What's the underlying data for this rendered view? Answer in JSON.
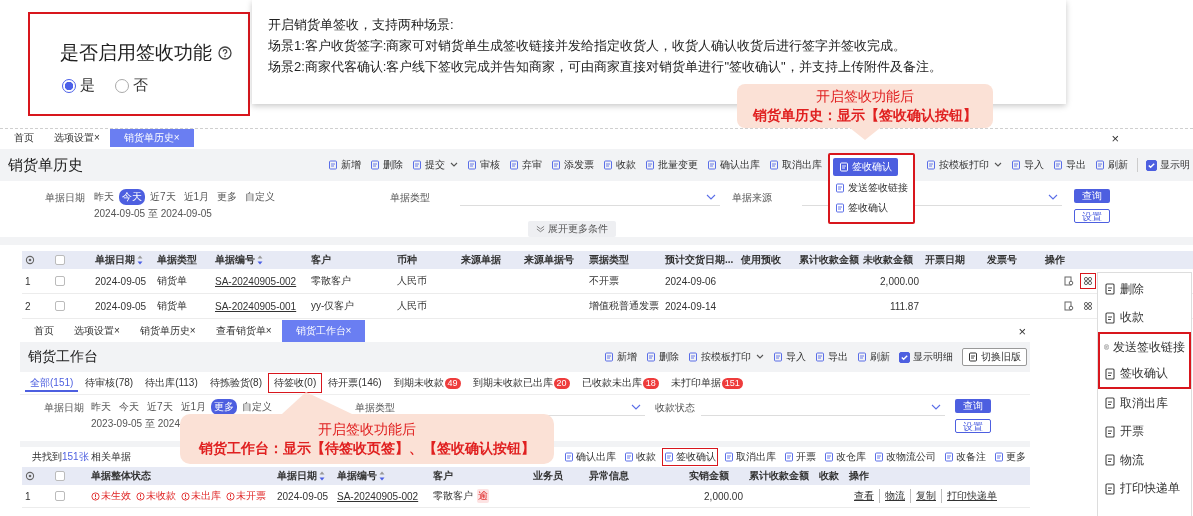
{
  "setting": {
    "title": "是否启用签收功能",
    "options": [
      {
        "label": "是",
        "selected": true
      },
      {
        "label": "否",
        "selected": false
      }
    ]
  },
  "tooltip": {
    "lines": [
      "开启销货单签收，支持两种场景:",
      "场景1:客户收货签字:商家可对销货单生成签收链接并发给指定收货人，收货人确认收货后进行签字并签收完成。",
      "场景2:商家代客确认:客户线下签收完成并告知商家，可由商家直接对销货单进行\"签收确认\"，并支持上传附件及备注。"
    ]
  },
  "callouts": [
    {
      "title": "开启签收功能后",
      "text": "销货单历史：显示【签收确认按钮】"
    },
    {
      "title": "开启签收功能后",
      "text": "销货工作台：显示【待签收页签】、【签收确认按钮】"
    }
  ],
  "history": {
    "tabs": [
      {
        "label": "首页",
        "selected": false
      },
      {
        "label": "选项设置",
        "close": "×",
        "selected": false
      },
      {
        "label": "销货单历史",
        "close": "×",
        "selected": true
      }
    ],
    "close": "×",
    "title": "销货单历史",
    "toolbar": [
      {
        "label": "新增",
        "kind": "button"
      },
      {
        "label": "删除",
        "kind": "button"
      },
      {
        "label": "提交",
        "kind": "dropdown"
      },
      {
        "label": "审核",
        "kind": "button"
      },
      {
        "label": "弃审",
        "kind": "button"
      },
      {
        "label": "添发票",
        "kind": "button"
      },
      {
        "label": "收款",
        "kind": "button"
      },
      {
        "label": "批量变更",
        "kind": "button"
      },
      {
        "label": "确认出库",
        "kind": "button"
      },
      {
        "label": "取消出库",
        "kind": "button"
      },
      {
        "label": "签收确认",
        "kind": "primary",
        "menu": {
          "annotated": true,
          "items": [
            "发送签收链接",
            "签收确认"
          ]
        }
      },
      {
        "label": "按模板打印",
        "kind": "dropdown"
      },
      {
        "label": "导入",
        "kind": "button"
      },
      {
        "label": "导出",
        "kind": "button"
      },
      {
        "label": "刷新",
        "kind": "button"
      },
      {
        "label": "显示明",
        "kind": "checkbox",
        "checked": true
      }
    ],
    "filters": {
      "date_label": "单据日期",
      "chips": [
        {
          "label": "昨天",
          "selected": false
        },
        {
          "label": "今天",
          "selected": true
        },
        {
          "label": "近7天",
          "selected": false
        },
        {
          "label": "近1月",
          "selected": false
        },
        {
          "label": "更多",
          "selected": false
        },
        {
          "label": "自定义",
          "selected": false
        }
      ],
      "date_range": "2024-09-05 至 2024-09-05",
      "selects": [
        "单据类型",
        "单据来源"
      ],
      "buttons": [
        {
          "label": "查询",
          "kind": "primary"
        },
        {
          "label": "设置",
          "kind": "outline"
        }
      ],
      "expand": "展开更多条件"
    },
    "table": {
      "select_all_checked": false,
      "columns": [
        {
          "label": "单据日期",
          "sortable": true
        },
        {
          "label": "单据类型"
        },
        {
          "label": "单据编号",
          "kind": "link",
          "sortable": true
        },
        {
          "label": "客户"
        },
        {
          "label": "币种"
        },
        {
          "label": "来源单据"
        },
        {
          "label": "来源单据号"
        },
        {
          "label": "票据类型"
        },
        {
          "label": "预计交货日期..."
        },
        {
          "label": "使用预收"
        },
        {
          "label": "累计收款金额",
          "kind": "number"
        },
        {
          "label": "未收款金额",
          "kind": "number"
        },
        {
          "label": "开票日期"
        },
        {
          "label": "发票号"
        },
        {
          "label": "操作",
          "kind": "ops"
        }
      ],
      "rows": [
        {
          "no": "1",
          "checked": false,
          "annotated": true,
          "cells": [
            "2024-09-05",
            "销货单",
            "SA-20240905-002",
            "零散客户",
            "人民币",
            null,
            null,
            "不开票",
            "2024-09-06",
            null,
            null,
            "2,000.00",
            null,
            null,
            null
          ]
        },
        {
          "no": "2",
          "checked": false,
          "annotated": false,
          "cells": [
            "2024-09-05",
            "销货单",
            "SA-20240905-001",
            "yy-仅客户",
            "人民币",
            null,
            null,
            "增值税普通发票",
            "2024-09-14",
            null,
            null,
            "111.87",
            null,
            null,
            null
          ]
        }
      ]
    }
  },
  "row_menu": {
    "items": [
      {
        "label": "删除",
        "annotated": false
      },
      {
        "label": "收款",
        "annotated": false
      },
      {
        "label": "发送签收链接",
        "annotated": true
      },
      {
        "label": "签收确认",
        "annotated": true
      },
      {
        "label": "取消出库",
        "annotated": false
      },
      {
        "label": "开票",
        "annotated": false
      },
      {
        "label": "物流",
        "annotated": false
      },
      {
        "label": "打印快递单",
        "annotated": false
      }
    ]
  },
  "workbench": {
    "tabs": [
      {
        "label": "首页",
        "selected": false
      },
      {
        "label": "选项设置",
        "close": "×",
        "selected": false
      },
      {
        "label": "销货单历史",
        "close": "×",
        "selected": false
      },
      {
        "label": "查看销货单",
        "close": "×",
        "selected": false
      },
      {
        "label": "销货工作台",
        "close": "×",
        "selected": true
      }
    ],
    "close": "×",
    "title": "销货工作台",
    "toolbar": [
      {
        "label": "新增",
        "kind": "button"
      },
      {
        "label": "删除",
        "kind": "button"
      },
      {
        "label": "按模板打印",
        "kind": "dropdown"
      },
      {
        "label": "导入",
        "kind": "button"
      },
      {
        "label": "导出",
        "kind": "button"
      },
      {
        "label": "刷新",
        "kind": "button"
      },
      {
        "label": "显示明细",
        "kind": "checkbox",
        "checked": true
      },
      {
        "label": "切换旧版",
        "kind": "outline"
      }
    ],
    "status_tabs": [
      {
        "label": "全部(151)",
        "selected": true,
        "annotated": false
      },
      {
        "label": "待审核(78)",
        "selected": false,
        "annotated": false
      },
      {
        "label": "待出库(113)",
        "selected": false,
        "annotated": false
      },
      {
        "label": "待拣验货(8)",
        "selected": false,
        "annotated": false
      },
      {
        "label": "待签收(0)",
        "selected": false,
        "annotated": true
      },
      {
        "label": "待开票(146)",
        "selected": false,
        "annotated": false
      },
      {
        "label": "到期未收款",
        "badge": "49",
        "selected": false,
        "annotated": false
      },
      {
        "label": "到期未收款已出库",
        "badge": "20",
        "selected": false,
        "annotated": false
      },
      {
        "label": "已收款未出库",
        "badge": "18",
        "selected": false,
        "annotated": false
      },
      {
        "label": "未打印单据",
        "badge": "151",
        "selected": false,
        "annotated": false
      }
    ],
    "filters": {
      "date_label": "单据日期",
      "chips": [
        {
          "label": "昨天",
          "selected": false
        },
        {
          "label": "今天",
          "selected": false
        },
        {
          "label": "近7天",
          "selected": false
        },
        {
          "label": "近1月",
          "selected": false
        },
        {
          "label": "更多",
          "selected": true
        },
        {
          "label": "自定义",
          "selected": false
        }
      ],
      "date_range": "2023-09-05 至 2024",
      "selects": [
        "单据类型",
        "收款状态"
      ],
      "buttons": [
        {
          "label": "查询",
          "kind": "primary"
        },
        {
          "label": "设置",
          "kind": "outline"
        }
      ]
    },
    "result": {
      "prefix": "共找到",
      "count": "151张",
      "suffix": " 相关单据"
    },
    "actions": [
      {
        "label": "确认出库",
        "annotated": false
      },
      {
        "label": "收款",
        "annotated": false
      },
      {
        "label": "签收确认",
        "annotated": true
      },
      {
        "label": "取消出库",
        "annotated": false
      },
      {
        "label": "开票",
        "annotated": false
      },
      {
        "label": "改仓库",
        "annotated": false
      },
      {
        "label": "改物流公司",
        "annotated": false
      },
      {
        "label": "改备注",
        "annotated": false
      },
      {
        "label": "更多",
        "annotated": false
      }
    ],
    "table": {
      "select_all_checked": false,
      "columns": [
        {
          "label": "单据整体状态",
          "kind": "status"
        },
        {
          "label": "单据日期",
          "sortable": true
        },
        {
          "label": "单据编号",
          "kind": "link",
          "sortable": true
        },
        {
          "label": "客户",
          "kind": "customer"
        },
        {
          "label": "业务员"
        },
        {
          "label": "异常信息"
        },
        {
          "label": "实销金额",
          "kind": "number"
        },
        {
          "label": "累计收款金额",
          "kind": "number"
        },
        {
          "label": "收款"
        },
        {
          "label": "操作",
          "kind": "links"
        }
      ],
      "rows": [
        {
          "no": "1",
          "checked": false,
          "badge": "逾",
          "cells": [
            [
              "未生效",
              "未收款",
              "未出库",
              "未开票"
            ],
            "2024-09-05",
            "SA-20240905-002",
            "零散客户",
            null,
            null,
            "2,000.00",
            null,
            null,
            [
              "查看",
              "物流",
              "复制",
              "打印快递单"
            ]
          ]
        }
      ]
    }
  }
}
